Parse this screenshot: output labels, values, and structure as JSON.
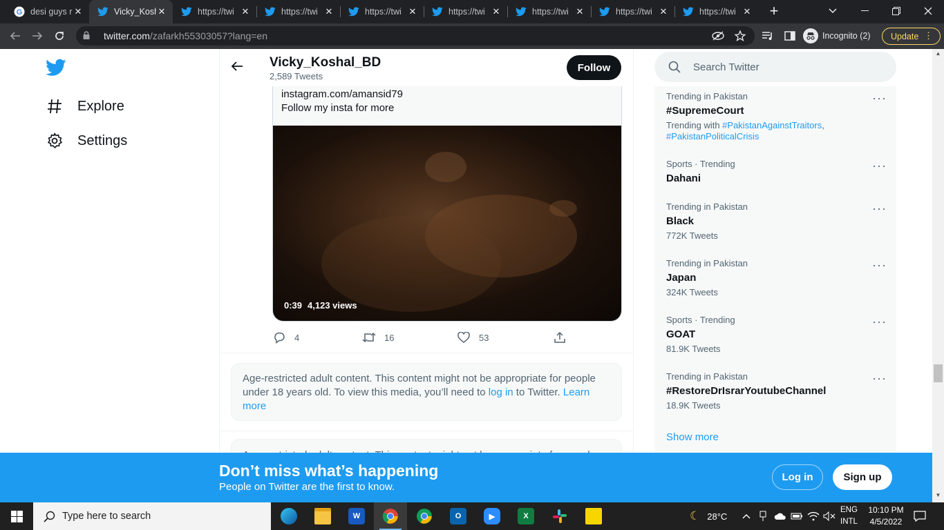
{
  "browser": {
    "tabs": [
      {
        "title": "desi guys r",
        "icon": "google-icon",
        "active": false
      },
      {
        "title": "Vicky_Kosh",
        "icon": "twitter-icon",
        "active": true
      },
      {
        "title": "https://twi",
        "icon": "twitter-icon",
        "active": false
      },
      {
        "title": "https://twi",
        "icon": "twitter-icon",
        "active": false
      },
      {
        "title": "https://twi",
        "icon": "twitter-icon",
        "active": false
      },
      {
        "title": "https://twi",
        "icon": "twitter-icon",
        "active": false
      },
      {
        "title": "https://twi",
        "icon": "twitter-icon",
        "active": false
      },
      {
        "title": "https://twi",
        "icon": "twitter-icon",
        "active": false
      },
      {
        "title": "https://twi",
        "icon": "twitter-icon",
        "active": false
      }
    ],
    "url_host": "twitter.com",
    "url_path": "/zafarkh55303057?lang=en",
    "incognito_label": "Incognito (2)",
    "update_label": "Update"
  },
  "nav": {
    "explore": "Explore",
    "settings": "Settings"
  },
  "profile": {
    "name": "Vicky_Koshal_BD",
    "tweet_count": "2,589 Tweets",
    "follow_label": "Follow"
  },
  "tweet": {
    "link_line": "instagram.com/amansid79",
    "text_line": "Follow my insta for more",
    "video_duration": "0:39",
    "video_views": "4,123 views",
    "replies": "4",
    "retweets": "16",
    "likes": "53"
  },
  "age_notice": {
    "text_before": "Age-restricted adult content. This content might not be appropriate for people under 18 years old. To view this media, you’ll need to ",
    "login_link": "log in",
    "text_middle": " to Twitter. ",
    "learn_more": "Learn more",
    "partial_second": "Age-restricted adult content. This content might not be appropriate for people"
  },
  "search": {
    "placeholder": "Search Twitter"
  },
  "trends": [
    {
      "meta": "Trending in Pakistan",
      "name": "#SupremeCourt",
      "sub_prefix": "Trending with ",
      "sub_links": [
        "#PakistanAgainstTraitors",
        "#PakistanPoliticalCrisis"
      ]
    },
    {
      "meta": "Sports · Trending",
      "name": "Dahani",
      "sub": ""
    },
    {
      "meta": "Trending in Pakistan",
      "name": "Black",
      "sub": "772K Tweets"
    },
    {
      "meta": "Trending in Pakistan",
      "name": "Japan",
      "sub": "324K Tweets"
    },
    {
      "meta": "Sports · Trending",
      "name": "GOAT",
      "sub": "81.9K Tweets"
    },
    {
      "meta": "Trending in Pakistan",
      "name": "#RestoreDrIsrarYoutubeChannel",
      "sub": "18.9K Tweets"
    }
  ],
  "show_more": "Show more",
  "banner": {
    "headline": "Don’t miss what’s happening",
    "subline": "People on Twitter are the first to know.",
    "login": "Log in",
    "signup": "Sign up"
  },
  "taskbar": {
    "search_placeholder": "Type here to search",
    "weather": "28°C",
    "lang_top": "ENG",
    "lang_bottom": "INTL",
    "time": "10:10 PM",
    "date": "4/5/2022"
  },
  "colors": {
    "twitter_blue": "#1d9bf0",
    "chrome_dark": "#202124",
    "update_yellow": "#fdd663"
  }
}
